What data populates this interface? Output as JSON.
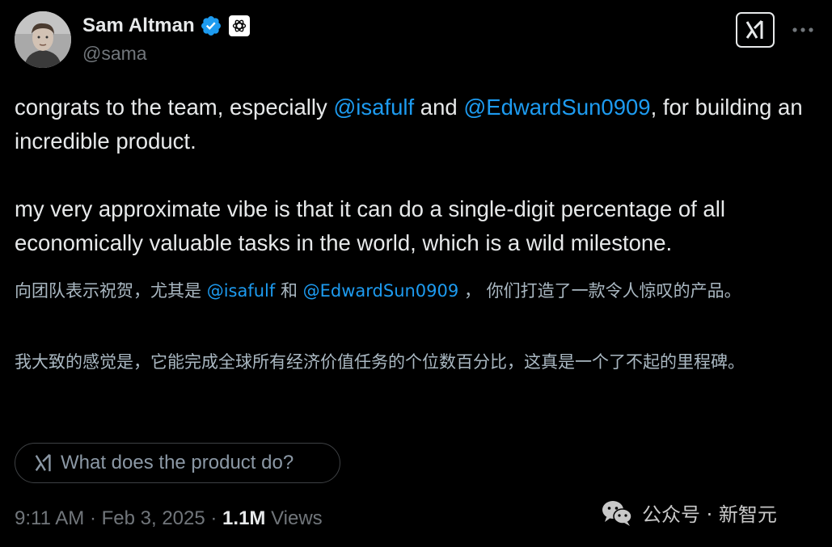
{
  "author": {
    "display_name": "Sam Altman",
    "handle": "@sama",
    "verified": true,
    "affiliate_badge": "openai-logo-icon",
    "avatar": "profile-photo"
  },
  "header_actions": {
    "grok_button": "grok-icon",
    "more_button": "more-icon"
  },
  "tweet": {
    "p1_prefix": "congrats to the team, especially ",
    "mention1": "@isafulf",
    "p1_mid": " and ",
    "mention2": "@EdwardSun0909",
    "p1_suffix": ", for building an incredible product.",
    "p2": "my very approximate vibe is that it can do a single-digit percentage of all economically valuable tasks in the world, which is a wild milestone."
  },
  "translation": {
    "t1_prefix": "向团队表示祝贺，尤其是 ",
    "mention1": "@isafulf",
    "t1_mid": " 和 ",
    "mention2": "@EdwardSun0909",
    "t1_suffix": " ， 你们打造了一款令人惊叹的产品。",
    "t2": "我大致的感觉是，它能完成全球所有经济价值任务的个位数百分比，这真是一个了不起的里程碑。"
  },
  "grok_prompt": {
    "label": "What does the product do?"
  },
  "meta": {
    "time": "9:11 AM",
    "separator": " · ",
    "date": "Feb 3, 2025",
    "views_count": "1.1M",
    "views_label": " Views"
  },
  "watermark": {
    "text": "公众号 · 新智元"
  },
  "colors": {
    "background": "#000000",
    "text": "#e7e9ea",
    "secondary": "#71767b",
    "mention": "#1d9bf0",
    "verified": "#1d9bf0"
  }
}
